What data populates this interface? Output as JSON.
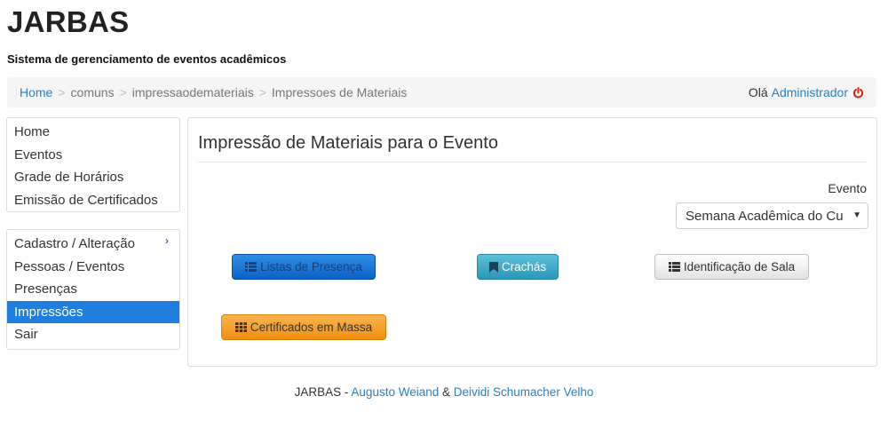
{
  "app": {
    "title": "JARBAS",
    "subtitle": "Sistema de gerenciamento de eventos acadêmicos"
  },
  "breadcrumb": {
    "items": [
      "Home",
      "comuns",
      "impressaodemateriais",
      "Impressoes de Materiais"
    ],
    "separator": ">"
  },
  "user": {
    "greeting": "Olá",
    "name": "Administrador",
    "logout_icon": "power-icon"
  },
  "menu_top": {
    "items": [
      "Home",
      "Eventos",
      "Grade de Horários",
      "Emissão de Certificados"
    ]
  },
  "menu_bottom": {
    "items": [
      "Cadastro / Alteração",
      "Pessoas / Eventos",
      "Presenças",
      "Impressões",
      "Sair"
    ],
    "active": "Impressões"
  },
  "panel": {
    "title": "Impressão de Materiais para o Evento",
    "event_label": "Evento",
    "event_selected": "Semana Acadêmica do Cu"
  },
  "buttons": {
    "presence_lists": "Listas de Presença",
    "badges": "Crachás",
    "room_id": "Identificação de Sala",
    "mass_certificates": "Certificados em Massa"
  },
  "footer": {
    "prefix": "JARBAS - ",
    "author1": "Augusto Weiand",
    "amp": " & ",
    "author2": "Deividi Schumacher Velho"
  },
  "colors": {
    "link": "#2a7fc1",
    "active_menu": "#1e7fe0",
    "primary": "#0d62c8",
    "info": "#2b97b8",
    "warning": "#f0900f",
    "logout": "#d9230f"
  }
}
